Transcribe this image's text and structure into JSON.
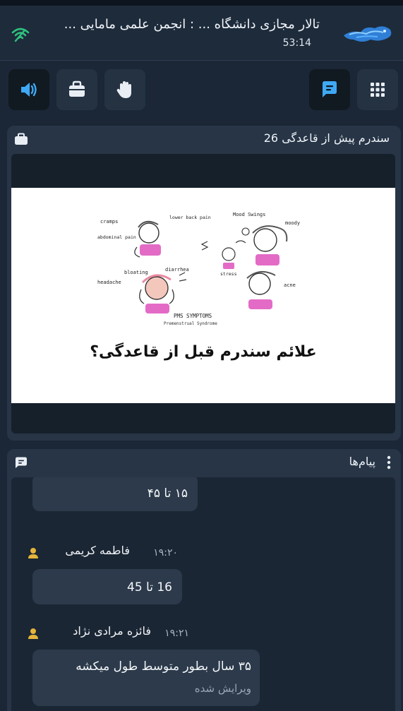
{
  "header": {
    "title": "تالار مجازی دانشگاه ... : انجمن علمی مامایی ...",
    "timer": "53:14",
    "logo_icon": "cloud-dragon-logo",
    "connection_icon": "signal-icon"
  },
  "toolbar": {
    "buttons": [
      {
        "name": "speaker",
        "icon": "speaker-icon",
        "active": true
      },
      {
        "name": "material",
        "icon": "briefcase-icon",
        "active": false
      },
      {
        "name": "raise-hand",
        "icon": "hand-icon",
        "active": false
      },
      {
        "name": "chat",
        "icon": "chat-icon",
        "active": true
      },
      {
        "name": "apps",
        "icon": "grid-icon",
        "active": false
      }
    ]
  },
  "presentation": {
    "title": "سندرم پیش از قاعدگی 26",
    "slide": {
      "caption": "علائم سندرم قبل از قاعدگی؟",
      "labels": {
        "cramps": "cramps",
        "lower_back_pain": "lower back pain",
        "abdominal_pain": "abdominal pain",
        "mood_swings": "Mood Swings",
        "moody": "moody",
        "bloating": "bloating",
        "diarrhea": "diarrhea",
        "stress": "stress",
        "headache": "headache",
        "acne": "acne",
        "pms_symptoms": "PMS SYMPTOMS",
        "premenstrual": "Premenstrual Syndrome"
      }
    }
  },
  "chat": {
    "title": "پیام‌ها",
    "messages": [
      {
        "sender": "",
        "time": "",
        "text": "۱۵ تا ۴۵",
        "edited": ""
      },
      {
        "sender": "فاطمه کریمی",
        "time": "۱۹:۲۰",
        "text": "16 تا 45",
        "edited": ""
      },
      {
        "sender": "فائزه مرادی نژاد",
        "time": "۱۹:۲۱",
        "text": "۳۵ سال بطور متوسط طول میکشه",
        "edited": "ویرایش شده"
      }
    ]
  },
  "colors": {
    "background": "#1b2736",
    "panel": "#273546",
    "bubble": "#2c3a4b",
    "accent_blue": "#3fa9f5",
    "avatar_gold": "#e5b43a"
  }
}
